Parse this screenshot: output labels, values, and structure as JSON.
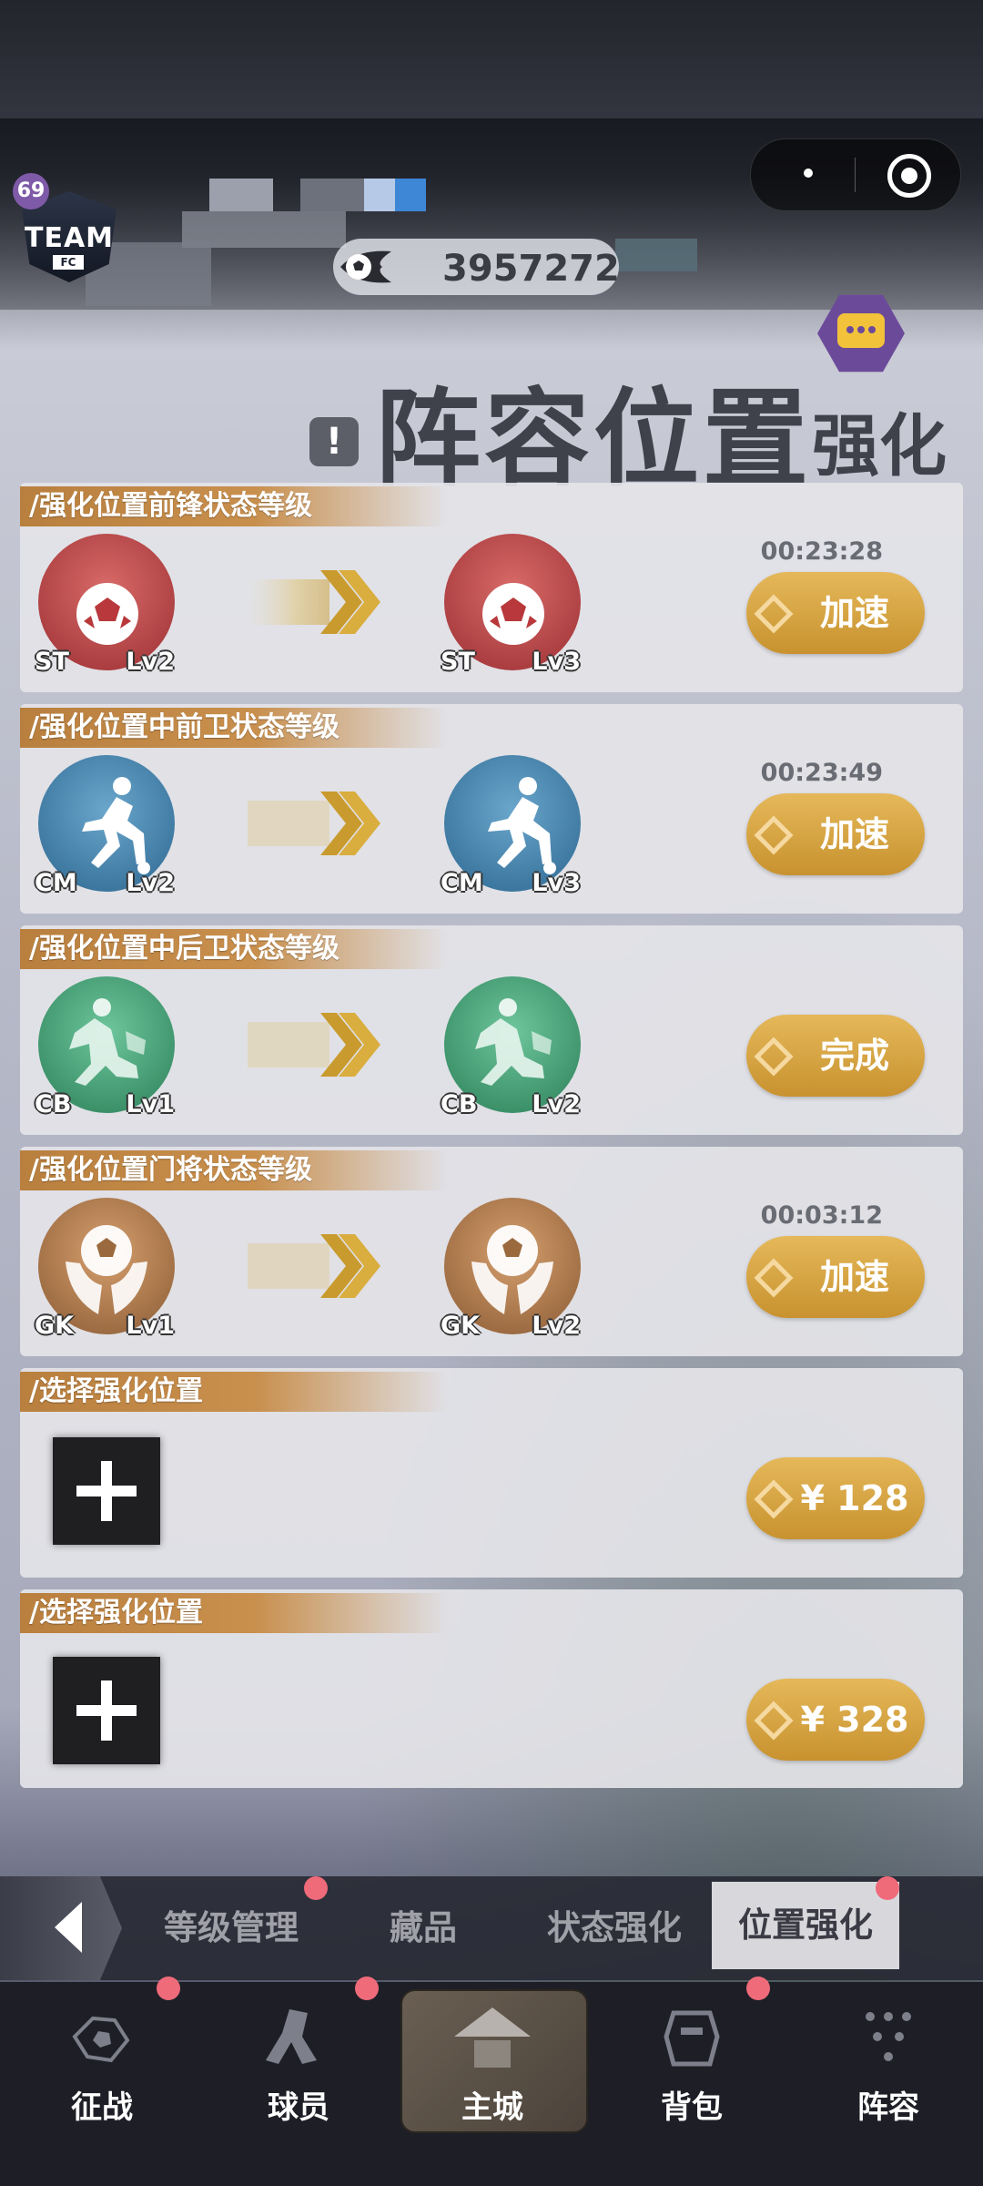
{
  "header": {
    "team_level": "69",
    "team_name": "TEAM",
    "team_fc": "FC",
    "coins": "3957272"
  },
  "title": {
    "main": "阵容位置",
    "sub": "强化",
    "info_icon": "!"
  },
  "cards": [
    {
      "title": "/强化位置前锋状态等级",
      "from": {
        "pos": "ST",
        "lv": "Lv2"
      },
      "to": {
        "pos": "ST",
        "lv": "Lv3"
      },
      "timer": "00:23:28",
      "button": "加速"
    },
    {
      "title": "/强化位置中前卫状态等级",
      "from": {
        "pos": "CM",
        "lv": "Lv2"
      },
      "to": {
        "pos": "CM",
        "lv": "Lv3"
      },
      "timer": "00:23:49",
      "button": "加速"
    },
    {
      "title": "/强化位置中后卫状态等级",
      "from": {
        "pos": "CB",
        "lv": "Lv1"
      },
      "to": {
        "pos": "CB",
        "lv": "Lv2"
      },
      "timer": "",
      "button": "完成"
    },
    {
      "title": "/强化位置门将状态等级",
      "from": {
        "pos": "GK",
        "lv": "Lv1"
      },
      "to": {
        "pos": "GK",
        "lv": "Lv2"
      },
      "timer": "00:03:12",
      "button": "加速"
    }
  ],
  "slots": [
    {
      "title": "/选择强化位置",
      "price": "¥ 128"
    },
    {
      "title": "/选择强化位置",
      "price": "¥ 328"
    }
  ],
  "subnav": {
    "tabs": [
      "等级管理",
      "藏品",
      "状态强化",
      "位置强化"
    ],
    "active": "位置强化"
  },
  "bottom_nav": [
    "征战",
    "球员",
    "主城",
    "背包",
    "阵容"
  ],
  "colors": {
    "accent_gold": "#d9a546",
    "badge_red": "#ef6b7a",
    "card_header": "#c08745",
    "st_red": "#c0474a",
    "cm_blue": "#3f7fa6",
    "cb_green": "#3f9a72",
    "gk_bronze": "#a8764a"
  }
}
